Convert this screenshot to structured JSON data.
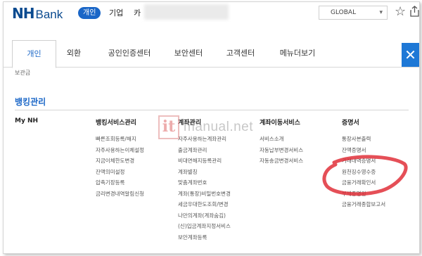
{
  "header": {
    "logo_nh": "NH",
    "logo_bank": "Bank",
    "personal_pill": "개인",
    "corporate": "기업",
    "card": "카",
    "language_select": "GLOBAL"
  },
  "tabs": [
    {
      "label": "개인",
      "active": true
    },
    {
      "label": "외환",
      "active": false
    },
    {
      "label": "공인인증센터",
      "active": false
    },
    {
      "label": "보안센터",
      "active": false
    },
    {
      "label": "고객센터",
      "active": false
    },
    {
      "label": "메뉴더보기",
      "active": false
    }
  ],
  "close_label": "✕",
  "sub_label": "보관금",
  "section_title": "뱅킹관리",
  "columns": [
    {
      "title": "My NH",
      "items": []
    },
    {
      "title": "뱅킹서비스관리",
      "items": [
        "빠른조회등록/해지",
        "자주사용하는이체설정",
        "지금이체한도변경",
        "잔액의미설정",
        "압축기장등록",
        "금리변경내역알림신청"
      ]
    },
    {
      "title": "계좌관리",
      "items": [
        "자주사용하는계좌관리",
        "출금계좌관리",
        "비대면해지등록관리",
        "계좌별칭",
        "맞춤계좌번호",
        "계좌(통장)비밀번호변경",
        "세금우대한도조회/변경",
        "나만의계좌(계좌숨김)",
        "(신)입금계좌지정서비스",
        "보안계좌등록"
      ]
    },
    {
      "title": "계좌이동서비스",
      "items": [
        "서비스소개",
        "자동납부변경서비스",
        "자동송금변경서비스"
      ]
    },
    {
      "title": "증명서",
      "items": [
        "통장사본출력",
        "잔액증명서",
        "거래내역증명서",
        "원천징수영수증",
        "금융거래확인서",
        "부채증명원",
        "금융거래종합보고서"
      ]
    }
  ],
  "watermark": {
    "box": "it",
    "text": "manual.net"
  },
  "colors": {
    "brand": "#0a4a8f",
    "accent": "#1a66c7",
    "close_button": "#1e78d6",
    "annotation": "#e0303a"
  }
}
